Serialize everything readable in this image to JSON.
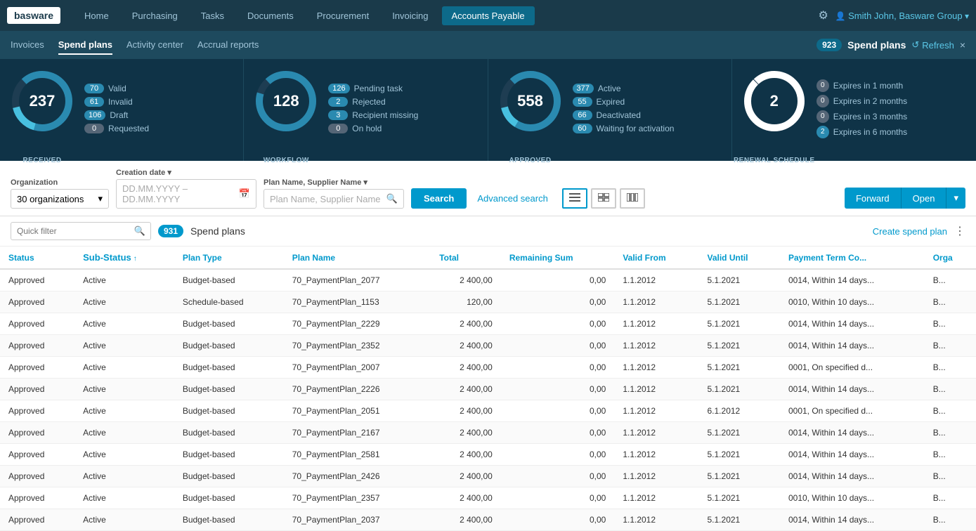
{
  "app": {
    "logo": "basware"
  },
  "topnav": {
    "links": [
      {
        "label": "Home",
        "active": false
      },
      {
        "label": "Purchasing",
        "active": false
      },
      {
        "label": "Tasks",
        "active": false
      },
      {
        "label": "Documents",
        "active": false
      },
      {
        "label": "Procurement",
        "active": false
      },
      {
        "label": "Invoicing",
        "active": false
      },
      {
        "label": "Accounts Payable",
        "active": true
      }
    ],
    "gear_label": "⚙",
    "user": "Smith John, Basware Group"
  },
  "subnav": {
    "links": [
      {
        "label": "Invoices",
        "active": false
      },
      {
        "label": "Spend plans",
        "active": true
      },
      {
        "label": "Activity center",
        "active": false
      },
      {
        "label": "Accrual reports",
        "active": false
      }
    ],
    "badge": "923",
    "title": "Spend plans",
    "refresh": "Refresh",
    "close": "×"
  },
  "cards": {
    "received": {
      "number": "237",
      "label": "RECEIVED",
      "stats": [
        {
          "value": "70",
          "label": "Valid",
          "color": "#2a8ab0"
        },
        {
          "value": "61",
          "label": "Invalid",
          "color": "#2a8ab0"
        },
        {
          "value": "106",
          "label": "Draft",
          "color": "#2a8ab0"
        },
        {
          "value": "0",
          "label": "Requested",
          "color": "#556677"
        }
      ]
    },
    "workflow": {
      "number": "128",
      "label": "WORKFLOW",
      "stats": [
        {
          "value": "126",
          "label": "Pending task",
          "color": "#2a8ab0"
        },
        {
          "value": "2",
          "label": "Rejected",
          "color": "#2a8ab0"
        },
        {
          "value": "3",
          "label": "Recipient missing",
          "color": "#2a8ab0"
        },
        {
          "value": "0",
          "label": "On hold",
          "color": "#556677"
        }
      ]
    },
    "approved": {
      "number": "558",
      "label": "APPROVED",
      "stats": [
        {
          "value": "377",
          "label": "Active",
          "color": "#2a8ab0"
        },
        {
          "value": "55",
          "label": "Expired",
          "color": "#2a8ab0"
        },
        {
          "value": "66",
          "label": "Deactivated",
          "color": "#2a8ab0"
        },
        {
          "value": "60",
          "label": "Waiting for activation",
          "color": "#2a8ab0"
        }
      ]
    },
    "renewal": {
      "number": "2",
      "label": "RENEWAL SCHEDULE",
      "stats": [
        {
          "value": "0",
          "label": "Expires in 1 month",
          "color": "#556677"
        },
        {
          "value": "0",
          "label": "Expires in 2 months",
          "color": "#556677"
        },
        {
          "value": "0",
          "label": "Expires in 3 months",
          "color": "#556677"
        },
        {
          "value": "2",
          "label": "Expires in 6 months",
          "color": "#2a8ab0"
        }
      ]
    }
  },
  "search": {
    "org_label": "Organization",
    "org_value": "30 organizations",
    "date_label": "Creation date",
    "date_placeholder": "DD.MM.YYYY  –  DD.MM.YYYY",
    "plan_label": "Plan Name, Supplier Name",
    "plan_placeholder": "Plan Name, Supplier Name",
    "search_btn": "Search",
    "advanced_btn": "Advanced search",
    "forward_btn": "Forward",
    "open_btn": "Open"
  },
  "table": {
    "quick_filter_placeholder": "Quick filter",
    "count": "931",
    "title": "Spend plans",
    "create_link": "Create spend plan",
    "columns": [
      {
        "label": "Status",
        "sortable": false
      },
      {
        "label": "Sub-Status",
        "sortable": true
      },
      {
        "label": "Plan Type",
        "sortable": false
      },
      {
        "label": "Plan Name",
        "sortable": false
      },
      {
        "label": "Total",
        "sortable": false
      },
      {
        "label": "Remaining Sum",
        "sortable": false
      },
      {
        "label": "Valid From",
        "sortable": false
      },
      {
        "label": "Valid Until",
        "sortable": false
      },
      {
        "label": "Payment Term Co...",
        "sortable": false
      },
      {
        "label": "Orga",
        "sortable": false
      }
    ],
    "rows": [
      {
        "status": "Approved",
        "substatus": "Active",
        "plantype": "Budget-based",
        "planname": "70_PaymentPlan_2077",
        "total": "2 400,00",
        "remaining": "0,00",
        "validfrom": "1.1.2012",
        "validuntil": "5.1.2021",
        "payterm": "0014, Within 14 days...",
        "org": "B..."
      },
      {
        "status": "Approved",
        "substatus": "Active",
        "plantype": "Schedule-based",
        "planname": "70_PaymentPlan_1153",
        "total": "120,00",
        "remaining": "0,00",
        "validfrom": "1.1.2012",
        "validuntil": "5.1.2021",
        "payterm": "0010, Within 10 days...",
        "org": "B..."
      },
      {
        "status": "Approved",
        "substatus": "Active",
        "plantype": "Budget-based",
        "planname": "70_PaymentPlan_2229",
        "total": "2 400,00",
        "remaining": "0,00",
        "validfrom": "1.1.2012",
        "validuntil": "5.1.2021",
        "payterm": "0014, Within 14 days...",
        "org": "B..."
      },
      {
        "status": "Approved",
        "substatus": "Active",
        "plantype": "Budget-based",
        "planname": "70_PaymentPlan_2352",
        "total": "2 400,00",
        "remaining": "0,00",
        "validfrom": "1.1.2012",
        "validuntil": "5.1.2021",
        "payterm": "0014, Within 14 days...",
        "org": "B..."
      },
      {
        "status": "Approved",
        "substatus": "Active",
        "plantype": "Budget-based",
        "planname": "70_PaymentPlan_2007",
        "total": "2 400,00",
        "remaining": "0,00",
        "validfrom": "1.1.2012",
        "validuntil": "5.1.2021",
        "payterm": "0001, On specified d...",
        "org": "B..."
      },
      {
        "status": "Approved",
        "substatus": "Active",
        "plantype": "Budget-based",
        "planname": "70_PaymentPlan_2226",
        "total": "2 400,00",
        "remaining": "0,00",
        "validfrom": "1.1.2012",
        "validuntil": "5.1.2021",
        "payterm": "0014, Within 14 days...",
        "org": "B..."
      },
      {
        "status": "Approved",
        "substatus": "Active",
        "plantype": "Budget-based",
        "planname": "70_PaymentPlan_2051",
        "total": "2 400,00",
        "remaining": "0,00",
        "validfrom": "1.1.2012",
        "validuntil": "6.1.2012",
        "payterm": "0001, On specified d...",
        "org": "B..."
      },
      {
        "status": "Approved",
        "substatus": "Active",
        "plantype": "Budget-based",
        "planname": "70_PaymentPlan_2167",
        "total": "2 400,00",
        "remaining": "0,00",
        "validfrom": "1.1.2012",
        "validuntil": "5.1.2021",
        "payterm": "0014, Within 14 days...",
        "org": "B..."
      },
      {
        "status": "Approved",
        "substatus": "Active",
        "plantype": "Budget-based",
        "planname": "70_PaymentPlan_2581",
        "total": "2 400,00",
        "remaining": "0,00",
        "validfrom": "1.1.2012",
        "validuntil": "5.1.2021",
        "payterm": "0014, Within 14 days...",
        "org": "B..."
      },
      {
        "status": "Approved",
        "substatus": "Active",
        "plantype": "Budget-based",
        "planname": "70_PaymentPlan_2426",
        "total": "2 400,00",
        "remaining": "0,00",
        "validfrom": "1.1.2012",
        "validuntil": "5.1.2021",
        "payterm": "0014, Within 14 days...",
        "org": "B..."
      },
      {
        "status": "Approved",
        "substatus": "Active",
        "plantype": "Budget-based",
        "planname": "70_PaymentPlan_2357",
        "total": "2 400,00",
        "remaining": "0,00",
        "validfrom": "1.1.2012",
        "validuntil": "5.1.2021",
        "payterm": "0010, Within 10 days...",
        "org": "B..."
      },
      {
        "status": "Approved",
        "substatus": "Active",
        "plantype": "Budget-based",
        "planname": "70_PaymentPlan_2037",
        "total": "2 400,00",
        "remaining": "0,00",
        "validfrom": "1.1.2012",
        "validuntil": "5.1.2021",
        "payterm": "0014, Within 14 days...",
        "org": "B..."
      }
    ]
  }
}
